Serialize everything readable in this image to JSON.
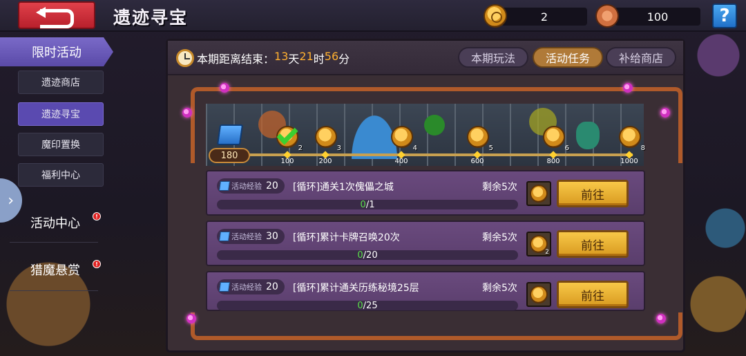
{
  "header": {
    "title": "遗迹寻宝",
    "currency_1": "2",
    "currency_2": "100",
    "help_label": "?"
  },
  "sidebar": {
    "section_label": "限时活动",
    "items": [
      {
        "label": "遗迹商店"
      },
      {
        "label": "遗迹寻宝"
      },
      {
        "label": "魔印置换"
      },
      {
        "label": "福利中心"
      }
    ],
    "activity_center": "活动中心",
    "demon_bounty": "猎魔悬赏",
    "alert_mark": "!",
    "expand_glyph": "›"
  },
  "panel": {
    "countdown_prefix": "本期距离结束：",
    "days": "13",
    "days_unit": "天",
    "hours": "21",
    "hours_unit": "时",
    "minutes": "56",
    "minutes_unit": "分",
    "tabs": [
      {
        "label": "本期玩法"
      },
      {
        "label": "活动任务"
      },
      {
        "label": "补给商店"
      }
    ]
  },
  "track": {
    "current_progress": "180",
    "milestones": [
      "100",
      "200",
      "400",
      "600",
      "800",
      "1000"
    ],
    "reward_counts": [
      "2",
      "3",
      "4",
      "5",
      "6",
      "8"
    ]
  },
  "tasks": [
    {
      "exp_label": "活动经验",
      "exp_value": "20",
      "name": "[循环]通关1次傀儡之城",
      "remaining": "剩余5次",
      "progress_done": "0",
      "progress_total": "/1",
      "reward_count": "",
      "button": "前往"
    },
    {
      "exp_label": "活动经验",
      "exp_value": "30",
      "name": "[循环]累计卡牌召唤20次",
      "remaining": "剩余5次",
      "progress_done": "0",
      "progress_total": "/20",
      "reward_count": "2",
      "button": "前往"
    },
    {
      "exp_label": "活动经验",
      "exp_value": "20",
      "name": "[循环]累计通关历练秘境25层",
      "remaining": "剩余5次",
      "progress_done": "0",
      "progress_total": "/25",
      "reward_count": "",
      "button": "前往"
    }
  ],
  "colors": {
    "accent_gold": "#ffb030",
    "tab_active": "#b07a38",
    "sidebar_active": "#5a4ab0",
    "progress_done": "#5ae04a"
  }
}
